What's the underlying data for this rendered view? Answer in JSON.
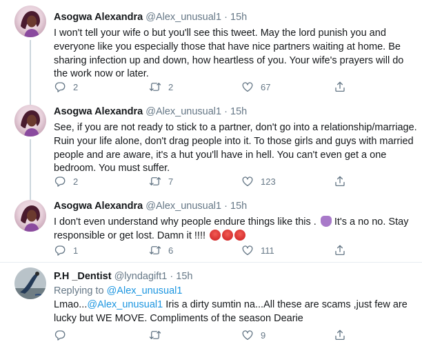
{
  "tweets": [
    {
      "name": "Asogwa Alexandra",
      "handle": "@Alex_unusual1",
      "dot": "·",
      "time": "15h",
      "lines": [
        "I won't tell your wife o but you'll see this tweet. May the lord punish you and",
        "everyone like you especially those that have nice partners waiting at home. Be",
        "sharing infection up and down, how heartless of you. Your wife's prayers will do",
        "the work now or later."
      ],
      "replies": "2",
      "retweets": "2",
      "likes": "67"
    },
    {
      "name": "Asogwa Alexandra",
      "handle": "@Alex_unusual1",
      "dot": "·",
      "time": "15h",
      "lines": [
        "See, if you are not ready to stick to a partner, don't go into a relationship/marriage.",
        "Ruin your life alone, don't drag people into it. To those girls and guys with married",
        "people and are aware, it's a hut you'll have in hell. You can't even get a one",
        "bedroom. You must suffer."
      ],
      "replies": "2",
      "retweets": "7",
      "likes": "123"
    },
    {
      "name": "Asogwa Alexandra",
      "handle": "@Alex_unusual1",
      "dot": "·",
      "time": "15h",
      "line1_a": "I don't even understand why people endure things like this .",
      "line1_b": " It's a no no. Stay",
      "line2": "responsible or get lost.  Damn it !!!! ",
      "replies": "1",
      "retweets": "6",
      "likes": "111"
    },
    {
      "name": "P.H _Dentist",
      "handle": "@lyndagift1",
      "dot": "·",
      "time": "15h",
      "replying_prefix": "Replying to ",
      "replying_to": "@Alex_unusual1",
      "line1_a": "Lmao...",
      "line1_mention": "@Alex_unusual1",
      "line1_b": "  Iris a dirty sumtin na...All these are scams ,just few are",
      "line2": "lucky but WE MOVE. Compliments of the season Dearie",
      "replies": "",
      "retweets": "",
      "likes": "9"
    }
  ],
  "icons": {
    "reply": "reply-icon",
    "retweet": "retweet-icon",
    "like": "heart-icon",
    "share": "share-icon"
  },
  "colors": {
    "text": "#14171a",
    "muted": "#657786",
    "link": "#1b95e0",
    "thread_line": "#ccd6dd",
    "divider": "#e6ecf0"
  }
}
